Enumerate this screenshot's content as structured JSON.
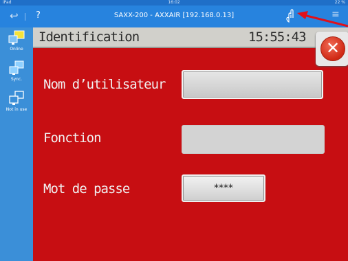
{
  "status_bar": {
    "device": "iPad",
    "clock": "16:02",
    "battery": "22 %"
  },
  "nav": {
    "back_glyph": "↩",
    "help_glyph": "?",
    "title": "SAXX-200 - AXXAIR [192.168.0.13]",
    "more_glyph": "≡"
  },
  "sidebar": {
    "items": [
      {
        "label": "Online",
        "icon": "online-monitor-icon"
      },
      {
        "label": "Sync.",
        "icon": "sync-icon"
      },
      {
        "label": "Not in use",
        "icon": "not-in-use-icon"
      }
    ]
  },
  "panel": {
    "title": "Identification",
    "time": "15:55:43",
    "close_glyph": "✕",
    "fields": {
      "username_label": "Nom d’utilisateur",
      "username_value": "",
      "function_label": "Fonction",
      "function_value": "",
      "password_label": "Mot de passe",
      "password_value": "****"
    }
  },
  "colors": {
    "accent": "#2783de",
    "panel_bg": "#c70e12",
    "header_bg": "#d1d0cb",
    "arrow": "#e0101a"
  }
}
